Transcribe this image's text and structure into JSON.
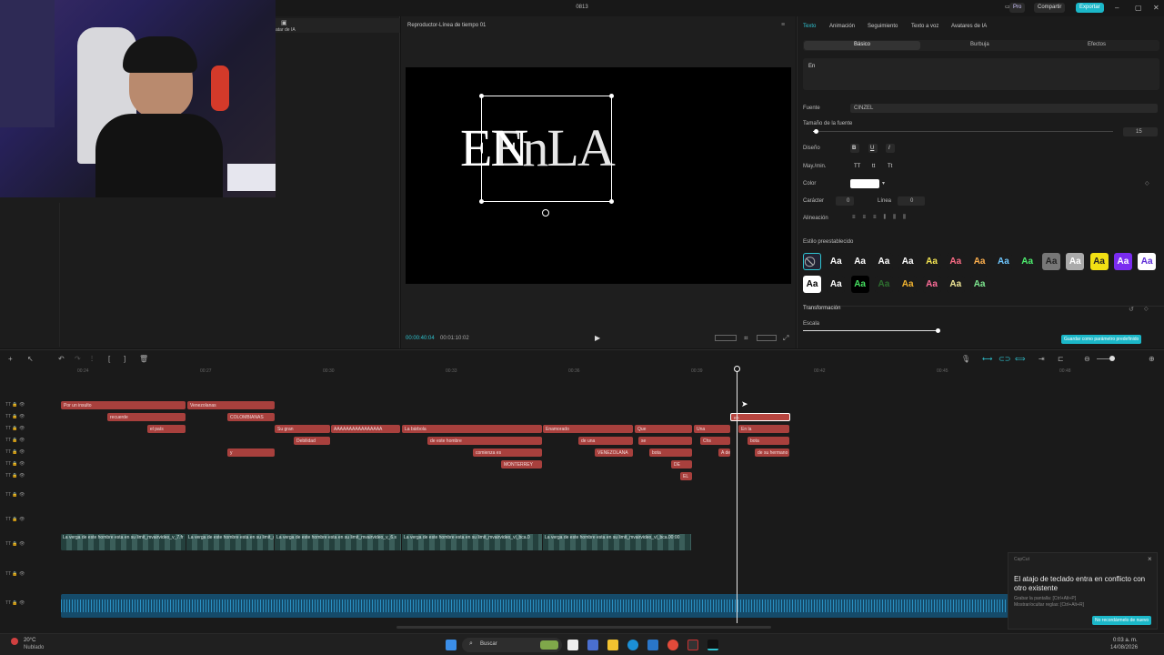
{
  "window": {
    "title": "0813",
    "pro_label": "Pro",
    "share_label": "Compartir",
    "export_label": "Exportar"
  },
  "left_panel": {
    "ai_avatar_label": "atar de IA"
  },
  "player": {
    "title": "Reproductor-Línea de tiempo 01",
    "canvas_text_1": "EN",
    "canvas_text_2": "EnLA",
    "time_current": "00:00:40:04",
    "time_total": "00:01:10:02"
  },
  "props": {
    "tabs": [
      "Texto",
      "Animación",
      "Seguimiento",
      "Texto a voz",
      "Avatares de IA"
    ],
    "subtabs": [
      "Básico",
      "Burbuja",
      "Efectos"
    ],
    "text_value": "En",
    "font_label": "Fuente",
    "font_value": "CINZEL",
    "size_label": "Tamaño de la fuente",
    "size_value": "15",
    "design_label": "Diseño",
    "case_label": "May./min.",
    "color_label": "Color",
    "char_label": "Carácter",
    "char_value": "0",
    "line_label": "Línea",
    "line_value": "0",
    "align_label": "Alineación",
    "preset_label": "Estilo preestablecido",
    "transform_label": "Transformación",
    "scale_label": "Escala",
    "save_preset_label": "Guardar como parámetro predefinido",
    "preset_glyph": "Aa"
  },
  "ruler": [
    "00:24",
    "00:27",
    "00:30",
    "00:33",
    "00:36",
    "00:39",
    "00:42",
    "00:45",
    "00:48"
  ],
  "clips": {
    "r1": [
      "Por un insulto",
      "Venezolanas"
    ],
    "r2": [
      "recuerde",
      "COLOMBIANAS",
      "en"
    ],
    "r3": [
      "el país",
      "Su gran",
      "AAAAAAAAAAAAAAAA",
      "La bárbola",
      "Enamorado",
      "Que",
      "Una",
      "En la"
    ],
    "r4": [
      "Debilidad",
      "de este hombre",
      "de una",
      "se",
      "Chs",
      "bota"
    ],
    "r5": [
      "y",
      "comienza es",
      "VENEZOLANA",
      "bota",
      "A de",
      "de su hermano"
    ],
    "r6": [
      "MONTERREY",
      "DE"
    ],
    "r7": [
      "EL"
    ]
  },
  "video_segments": [
    "La verga de este hombre esta en su limit_mvairvideo_v_7.fr",
    "La verga de este hombre esta en su limit_mvairvideo_v_7",
    "La verga de este hombre esta en su limit_mvairvideo_v_6.s",
    "La verga de este hombre esta en su limit_mvairvideo_vl_bca.0",
    "La verga de este hombre esta en su limit_mvairvideo_vl_bca.00:00"
  ],
  "toast": {
    "app": "CapCut",
    "title": "El atajo de teclado entra en conflicto con otro existente",
    "line1": "Grabar la pantalla: [Ctrl+Alt+P]",
    "line2": "Mostrar/ocultar reglas: [Ctrl+Alt+R]",
    "button": "No recordármelo de nuevo"
  },
  "taskbar": {
    "temp": "20°C",
    "weather": "Nublado",
    "search": "Buscar",
    "time": "0:03 a. m.",
    "date": "14/08/2026"
  }
}
